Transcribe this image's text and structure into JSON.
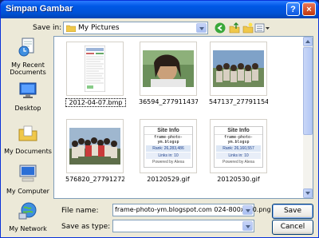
{
  "window": {
    "title": "Simpan Gambar",
    "help": "?",
    "close": "×"
  },
  "toolbar": {
    "save_in_label": "Save in:",
    "save_in_value": "My Pictures"
  },
  "places": [
    {
      "label": "My Recent Documents",
      "icon": "recent-documents-icon"
    },
    {
      "label": "Desktop",
      "icon": "desktop-icon"
    },
    {
      "label": "My Documents",
      "icon": "my-documents-icon"
    },
    {
      "label": "My Computer",
      "icon": "my-computer-icon"
    },
    {
      "label": "My Network",
      "icon": "my-network-icon"
    }
  ],
  "files": [
    {
      "name": "2012-04-07.bmp",
      "kind": "document",
      "selected": true
    },
    {
      "name": "36594_277911437570...",
      "kind": "photo-girl"
    },
    {
      "name": "547137_2779115495 7...",
      "kind": "photo-group"
    },
    {
      "name": "576820_277912721 60...",
      "kind": "photo-crowd"
    },
    {
      "name": "20120529.gif",
      "kind": "siteinfo",
      "card": {
        "title": "Site Info",
        "url": "frame-photo-ym.blogsp",
        "rank": "Rank: 26,283,486",
        "links": "Links in: 10",
        "powered": "Powered by Alexa"
      }
    },
    {
      "name": "20120530.gif",
      "kind": "siteinfo",
      "card": {
        "title": "Site Info",
        "url": "frame-photo-ym.blogsp",
        "rank": "Rank: 26,160,557",
        "links": "Links in: 10",
        "powered": "Powered by Alexa"
      }
    }
  ],
  "form": {
    "file_name_label": "File name:",
    "file_name_value": "frame-photo-ym.blogspot.com 024-800x800.png",
    "save_as_type_label": "Save as type:",
    "save_as_type_value": ""
  },
  "buttons": {
    "save": "Save",
    "cancel": "Cancel"
  },
  "colors": {
    "titlebar": "#0058e6",
    "dialog_bg": "#ece9d8",
    "field_border": "#7f9db9"
  }
}
